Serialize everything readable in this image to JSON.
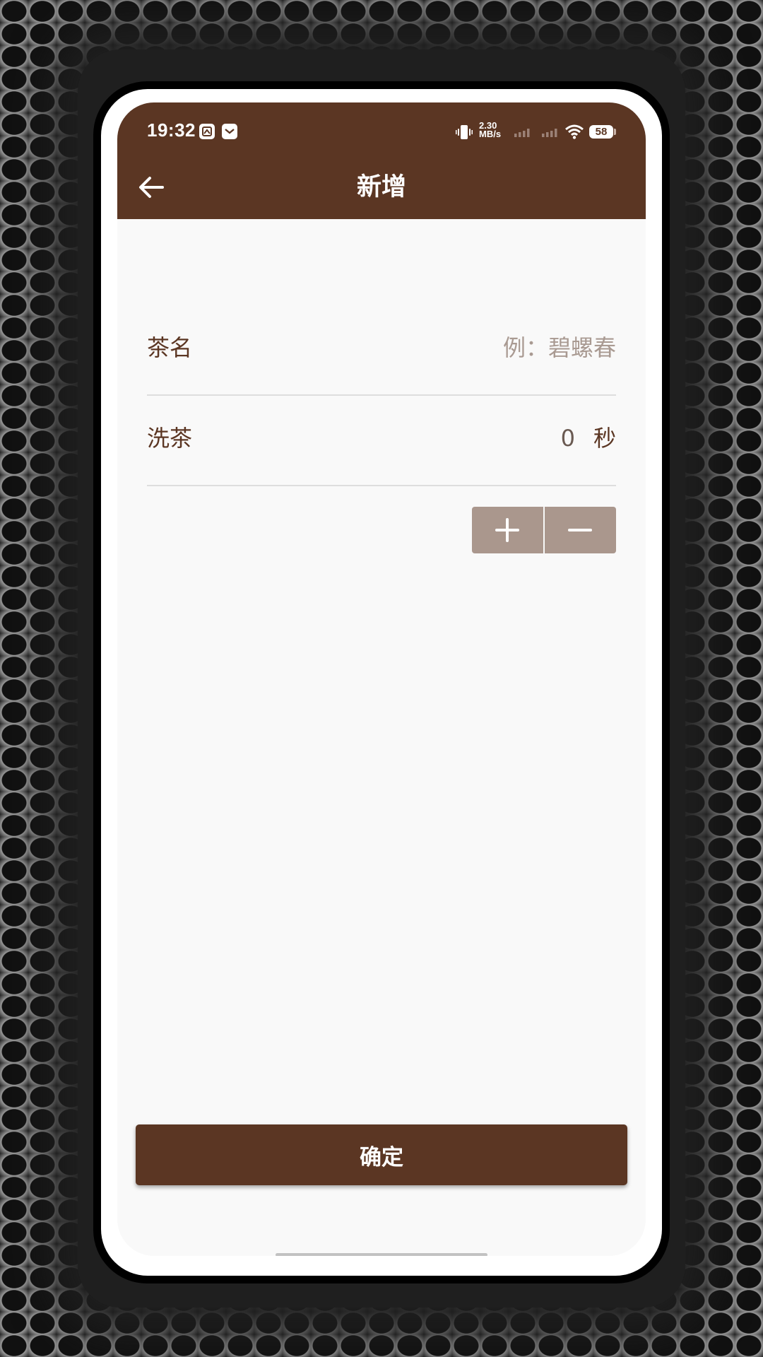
{
  "status_bar": {
    "time": "19:32",
    "net_speed_value": "2.30",
    "net_speed_unit": "MB/s",
    "battery": "58",
    "icons": [
      "gallery-icon",
      "mail-icon",
      "vibrate-icon",
      "signal-icon",
      "signal-icon",
      "wifi-icon",
      "battery-icon"
    ]
  },
  "header": {
    "title": "新增",
    "back_icon": "arrow-left-icon"
  },
  "form": {
    "tea_name": {
      "label": "茶名",
      "value": "",
      "placeholder": "例：碧螺春"
    },
    "wash_tea": {
      "label": "洗茶",
      "value": "0",
      "unit": "秒"
    },
    "stepper": {
      "plus_icon": "plus-icon",
      "minus_icon": "minus-icon"
    }
  },
  "actions": {
    "confirm_label": "确定"
  },
  "colors": {
    "primary": "#5b3623",
    "stepper": "#aa978d",
    "background": "#f9f9f9",
    "divider": "#dedede",
    "placeholder": "#a99a92"
  }
}
